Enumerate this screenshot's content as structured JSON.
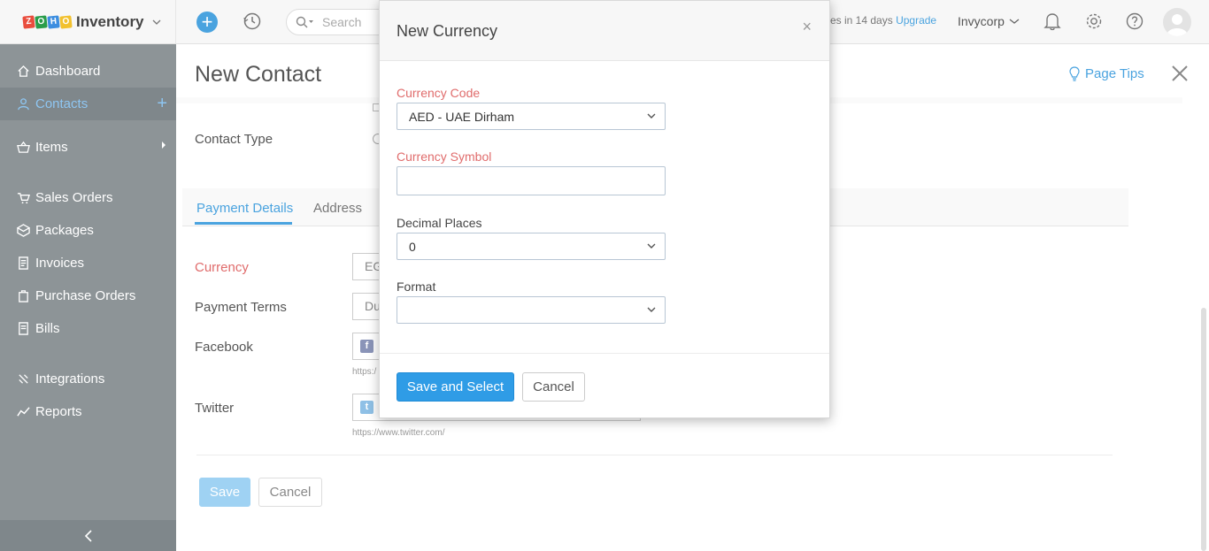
{
  "brand": {
    "logo_letters": [
      "Z",
      "O",
      "H",
      "O"
    ],
    "logo_colors": [
      "#e94d3d",
      "#2a9d4b",
      "#3d8ee0",
      "#f2c12e"
    ],
    "name": "Inventory"
  },
  "sidebar": {
    "items": [
      {
        "label": "Dashboard",
        "icon": "home-icon"
      },
      {
        "label": "Contacts",
        "icon": "user-icon",
        "active": true,
        "action": "+"
      },
      {
        "label": "Items",
        "icon": "basket-icon"
      },
      {
        "label": "Sales Orders",
        "icon": "cart-icon"
      },
      {
        "label": "Packages",
        "icon": "package-icon"
      },
      {
        "label": "Invoices",
        "icon": "invoice-icon"
      },
      {
        "label": "Purchase Orders",
        "icon": "purchase-icon"
      },
      {
        "label": "Bills",
        "icon": "bill-icon"
      },
      {
        "label": "Integrations",
        "icon": "integrations-icon"
      },
      {
        "label": "Reports",
        "icon": "reports-icon"
      }
    ],
    "collapse_icon": "chevron-left-icon"
  },
  "topbar": {
    "search_placeholder": "Search",
    "trial_text": "es in 14 days",
    "upgrade_label": "Upgrade",
    "org_name": "Invycorp"
  },
  "page": {
    "title": "New Contact",
    "page_tips": "Page Tips",
    "contact_type_label": "Contact Type",
    "tabs": [
      {
        "label": "Payment Details",
        "active": true
      },
      {
        "label": "Address"
      }
    ],
    "currency_label": "Currency",
    "currency_value": "EG",
    "payment_terms_label": "Payment Terms",
    "payment_terms_value": "Du",
    "facebook_label": "Facebook",
    "facebook_hint": "https:/",
    "twitter_label": "Twitter",
    "twitter_hint": "https://www.twitter.com/",
    "save_label": "Save",
    "cancel_label": "Cancel"
  },
  "modal": {
    "title": "New Currency",
    "close_glyph": "×",
    "currency_code_label": "Currency Code",
    "currency_code_value": "AED - UAE Dirham",
    "currency_symbol_label": "Currency Symbol",
    "currency_symbol_value": "",
    "decimal_places_label": "Decimal Places",
    "decimal_places_value": "0",
    "format_label": "Format",
    "format_value": "",
    "save_select_label": "Save and Select",
    "cancel_label": "Cancel"
  },
  "colors": {
    "accent": "#4aa3df",
    "required": "#e06c6c",
    "sidebar": "#8d9497",
    "primary_button": "#2f9ce6"
  }
}
